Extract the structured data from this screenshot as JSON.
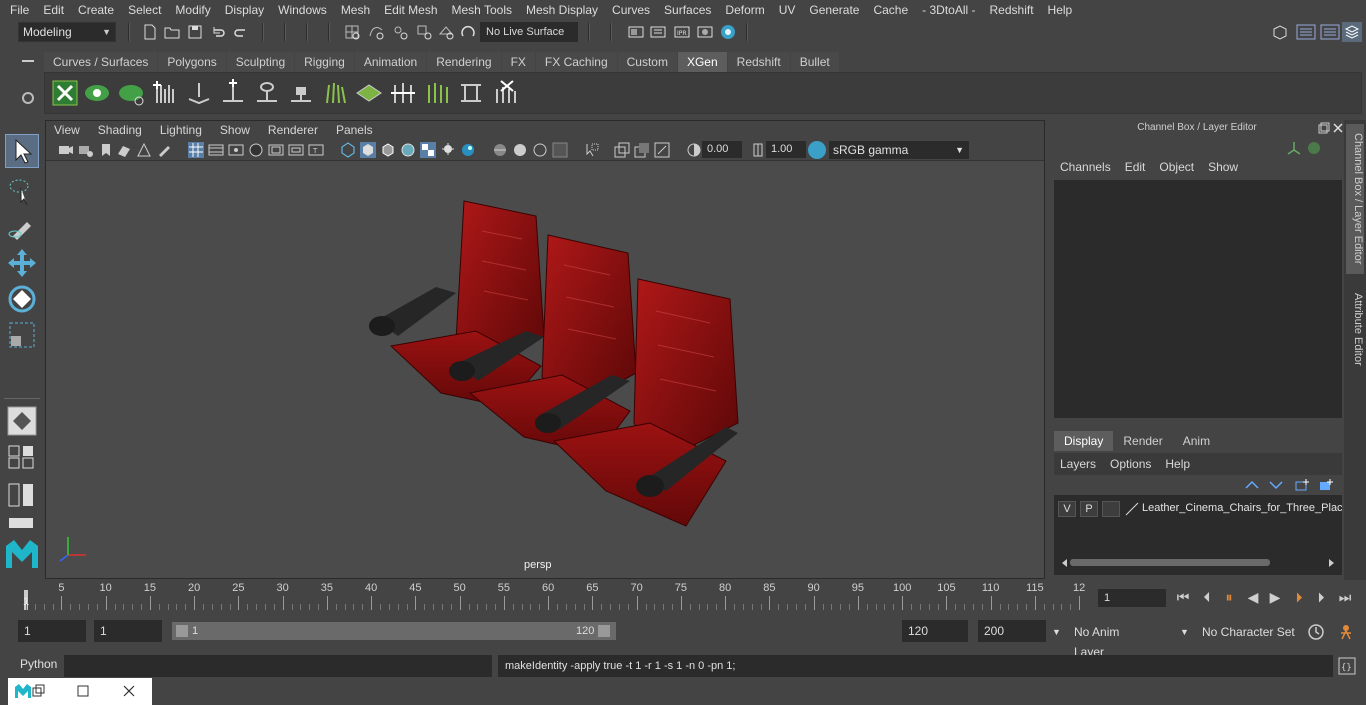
{
  "menubar": [
    "File",
    "Edit",
    "Create",
    "Select",
    "Modify",
    "Display",
    "Windows",
    "Mesh",
    "Edit Mesh",
    "Mesh Tools",
    "Mesh Display",
    "Curves",
    "Surfaces",
    "Deform",
    "UV",
    "Generate",
    "Cache",
    "- 3DtoAll -",
    "Redshift",
    "Help"
  ],
  "status": {
    "mode": "Modeling",
    "live_surface": "No Live Surface"
  },
  "shelf": {
    "tabs": [
      "Curves / Surfaces",
      "Polygons",
      "Sculpting",
      "Rigging",
      "Animation",
      "Rendering",
      "FX",
      "FX Caching",
      "Custom",
      "XGen",
      "Redshift",
      "Bullet"
    ],
    "active_tab": "XGen"
  },
  "viewport": {
    "menu": [
      "View",
      "Shading",
      "Lighting",
      "Show",
      "Renderer",
      "Panels"
    ],
    "exposure": "0.00",
    "gamma": "1.00",
    "color_space": "sRGB gamma",
    "camera_label": "persp"
  },
  "channel_box": {
    "title": "Channel Box / Layer Editor",
    "menu": [
      "Channels",
      "Edit",
      "Object",
      "Show"
    ]
  },
  "layer_editor": {
    "tabs": [
      "Display",
      "Render",
      "Anim"
    ],
    "active_tab": "Display",
    "menu": [
      "Layers",
      "Options",
      "Help"
    ],
    "layer": {
      "v": "V",
      "p": "P",
      "name": "Leather_Cinema_Chairs_for_Three_Places"
    }
  },
  "side_tabs": [
    "Channel Box / Layer Editor",
    "Attribute Editor"
  ],
  "timeline": {
    "ticks": [
      "5",
      "10",
      "15",
      "20",
      "25",
      "30",
      "35",
      "40",
      "45",
      "50",
      "55",
      "60",
      "65",
      "70",
      "75",
      "80",
      "85",
      "90",
      "95",
      "100",
      "105",
      "110",
      "115",
      "12"
    ],
    "start_label": "1",
    "current_frame": "1"
  },
  "range": {
    "start": "1",
    "playback_start": "1",
    "slider_start": "1",
    "slider_end": "120",
    "playback_end": "120",
    "end": "200",
    "anim_layer": "No Anim Layer",
    "character_set": "No Character Set"
  },
  "command": {
    "language": "Python",
    "output": "makeIdentity -apply true -t 1 -r 1 -s 1 -n 0 -pn 1;"
  }
}
